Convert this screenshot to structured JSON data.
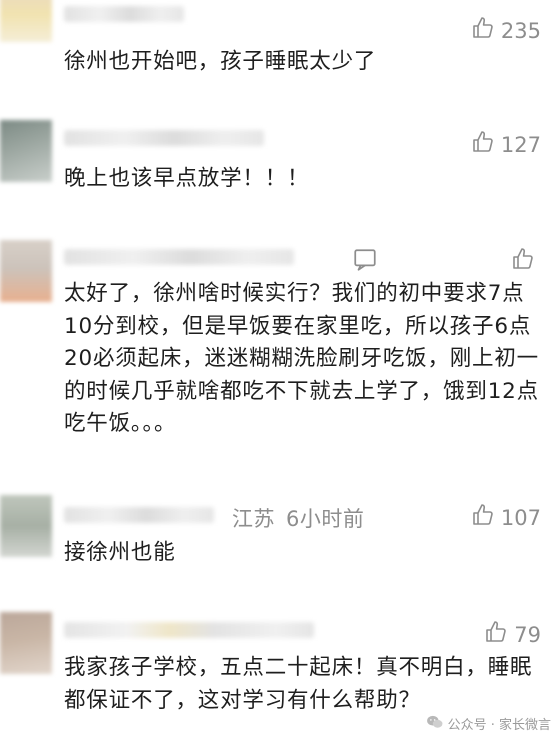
{
  "comments": [
    {
      "likes": "235",
      "text": "徐州也开始吧，孩子睡眠太少了"
    },
    {
      "likes": "127",
      "text": "晚上也该早点放学！！！"
    },
    {
      "likes": "",
      "text": "太好了，徐州啥时候实行？我们的初中要求7点10分到校，但是早饭要在家里吃，所以孩子6点20必须起床，迷迷糊糊洗脸刷牙吃饭，刚上初一的时候几乎就啥都吃不下就去上学了，饿到12点吃午饭。。。"
    },
    {
      "likes": "107",
      "location": "江苏",
      "time": "6小时前",
      "text": "接徐州也能"
    },
    {
      "likes": "79",
      "text": "我家孩子学校，五点二十起床！真不明白，睡眠都保证不了，这对学习有什么帮助？"
    }
  ],
  "watermark": "公众号 · 家长微言",
  "icons": [
    "thumbs-up-icon",
    "comment-icon",
    "wechat-icon"
  ]
}
